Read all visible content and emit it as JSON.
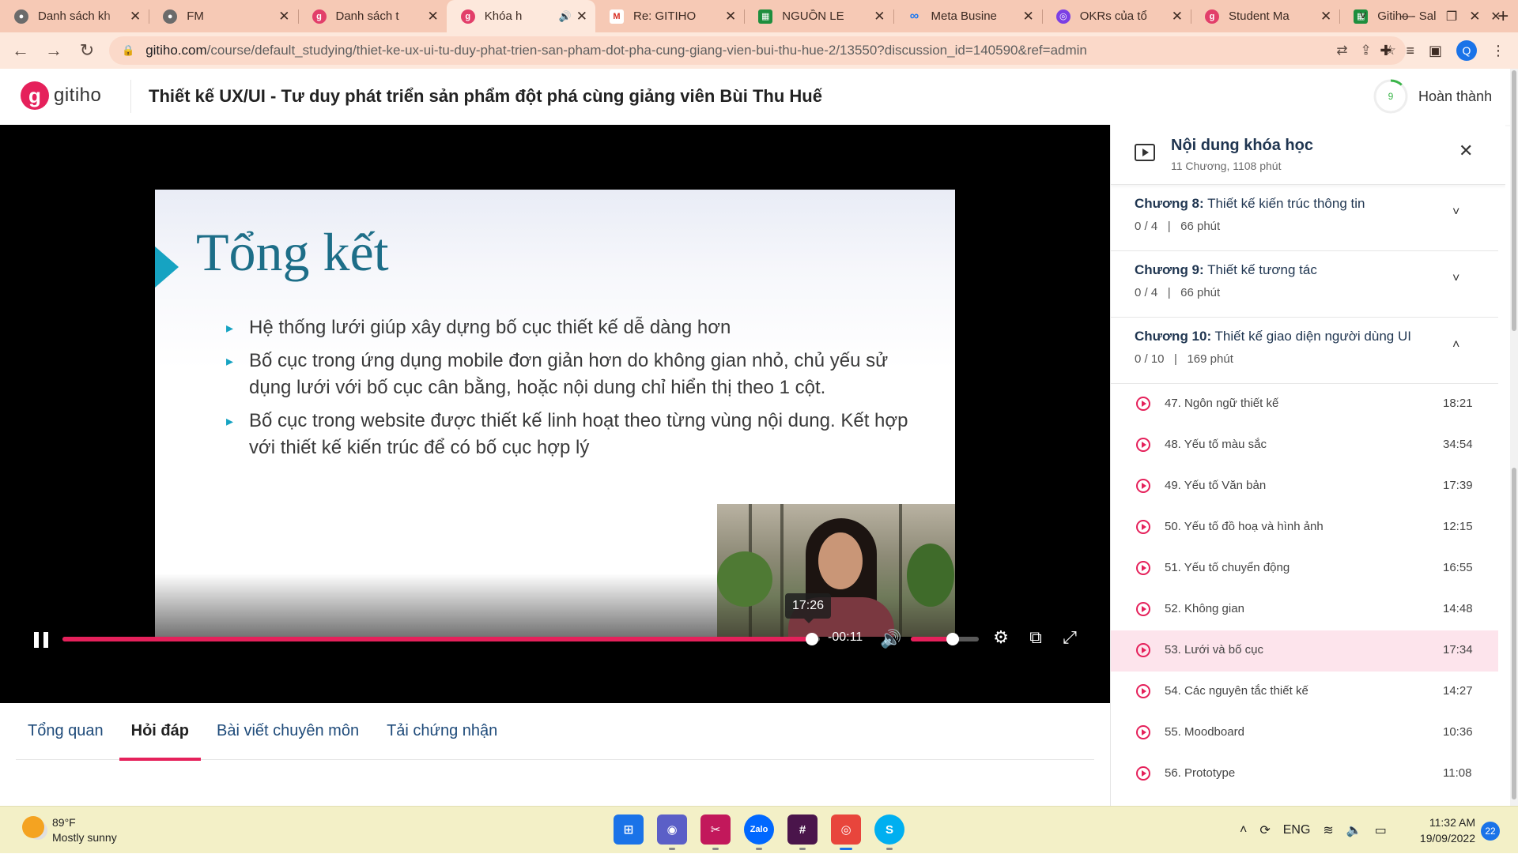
{
  "browser": {
    "tabs": [
      {
        "title": "Danh sách kh",
        "favicon": "globe-icon",
        "active": false
      },
      {
        "title": "FM",
        "favicon": "globe-icon",
        "active": false
      },
      {
        "title": "Danh sách t",
        "favicon": "gitiho-icon",
        "active": false
      },
      {
        "title": "Khóa h",
        "favicon": "gitiho-icon",
        "active": true,
        "audio": true
      },
      {
        "title": "Re: GITIHO",
        "favicon": "gmail-icon",
        "active": false
      },
      {
        "title": "NGUỒN LE",
        "favicon": "sheets-icon",
        "active": false
      },
      {
        "title": "Meta Busine",
        "favicon": "meta-icon",
        "active": false
      },
      {
        "title": "OKRs của tổ",
        "favicon": "okr-icon",
        "active": false
      },
      {
        "title": "Student Ma",
        "favicon": "gitiho-icon",
        "active": false
      },
      {
        "title": "Gitiho - Sal",
        "favicon": "sheets-icon",
        "active": false
      }
    ],
    "url_host": "gitiho.com",
    "url_path": "/course/default_studying/thiet-ke-ux-ui-tu-duy-phat-trien-san-pham-dot-pha-cung-giang-vien-bui-thu-hue-2/13550?discussion_id=140590&ref=admin",
    "profile_initial": "Q"
  },
  "header": {
    "logo_text": "gitiho",
    "course_title": "Thiết kế UX/UI - Tư duy phát triển sản phẩm đột phá cùng giảng viên Bùi Thu Huế",
    "progress_count": "9",
    "progress_fraction": 0.12,
    "complete_label": "Hoàn thành"
  },
  "video": {
    "slide_title": "Tổng kết",
    "bullets": [
      "Hệ thống lưới giúp xây dựng bố cục thiết kế dễ dàng hơn",
      "Bố cục trong ứng dụng mobile đơn giản hơn do không gian nhỏ, chủ yếu sử dụng lưới với bố cục cân bằng, hoặc nội dung chỉ hiển thị theo 1 cột.",
      "Bố cục trong website được thiết kế linh hoạt theo từng vùng nội dung. Kết hợp với thiết kế kiến trúc để có bố cục hợp lý"
    ],
    "hover_time": "17:26",
    "time_remaining": "-00:11",
    "progress_fraction": 0.99,
    "volume_fraction": 0.62,
    "accent_color": "#e5215b"
  },
  "subtabs": [
    {
      "label": "Tổng quan",
      "active": false
    },
    {
      "label": "Hỏi đáp",
      "active": true
    },
    {
      "label": "Bài viết chuyên môn",
      "active": false
    },
    {
      "label": "Tải chứng nhận",
      "active": false
    }
  ],
  "sidebar": {
    "title": "Nội dung khóa học",
    "subtitle": "11 Chương, 1108 phút",
    "chapters": [
      {
        "prefix": "Chương 8:",
        "name": "Thiết kế kiến trúc thông tin",
        "progress": "0 / 4",
        "sep": "|",
        "duration": "66 phút",
        "chevron": "˅"
      },
      {
        "prefix": "Chương 9:",
        "name": "Thiết kế tương tác",
        "progress": "0 / 4",
        "sep": "|",
        "duration": "66 phút",
        "chevron": "˅"
      },
      {
        "prefix": "Chương 10:",
        "name": "Thiết kế giao diện người dùng UI",
        "progress": "0 / 10",
        "sep": "|",
        "duration": "169 phút",
        "chevron": "˄"
      }
    ],
    "lessons": [
      {
        "name": "47. Ngôn ngữ thiết kế",
        "time": "18:21",
        "current": false
      },
      {
        "name": "48. Yếu tố màu sắc",
        "time": "34:54",
        "current": false
      },
      {
        "name": "49. Yếu tố Văn bản",
        "time": "17:39",
        "current": false
      },
      {
        "name": "50. Yếu tố đồ hoạ và hình ảnh",
        "time": "12:15",
        "current": false
      },
      {
        "name": "51. Yếu tố chuyển động",
        "time": "16:55",
        "current": false
      },
      {
        "name": "52. Không gian",
        "time": "14:48",
        "current": false
      },
      {
        "name": "53. Lưới và bố cục",
        "time": "17:34",
        "current": true
      },
      {
        "name": "54. Các nguyên tắc thiết kế",
        "time": "14:27",
        "current": false
      },
      {
        "name": "55. Moodboard",
        "time": "10:36",
        "current": false
      },
      {
        "name": "56. Prototype",
        "time": "11:08",
        "current": false
      }
    ]
  },
  "taskbar": {
    "weather_temp": "89°F",
    "weather_desc": "Mostly sunny",
    "apps": [
      {
        "name": "windows-start-icon",
        "label": "",
        "active": false
      },
      {
        "name": "teams-chat-icon",
        "label": "",
        "active": false
      },
      {
        "name": "snipping-tool-icon",
        "label": "",
        "active": false
      },
      {
        "name": "zalo-icon",
        "label": "Zalo",
        "active": false
      },
      {
        "name": "slack-icon",
        "label": "",
        "active": false
      },
      {
        "name": "chrome-icon",
        "label": "",
        "active": true
      },
      {
        "name": "skype-icon",
        "label": "S",
        "active": false
      }
    ],
    "language": "ENG",
    "time": "11:32 AM",
    "date": "19/09/2022",
    "notification_count": "22"
  }
}
